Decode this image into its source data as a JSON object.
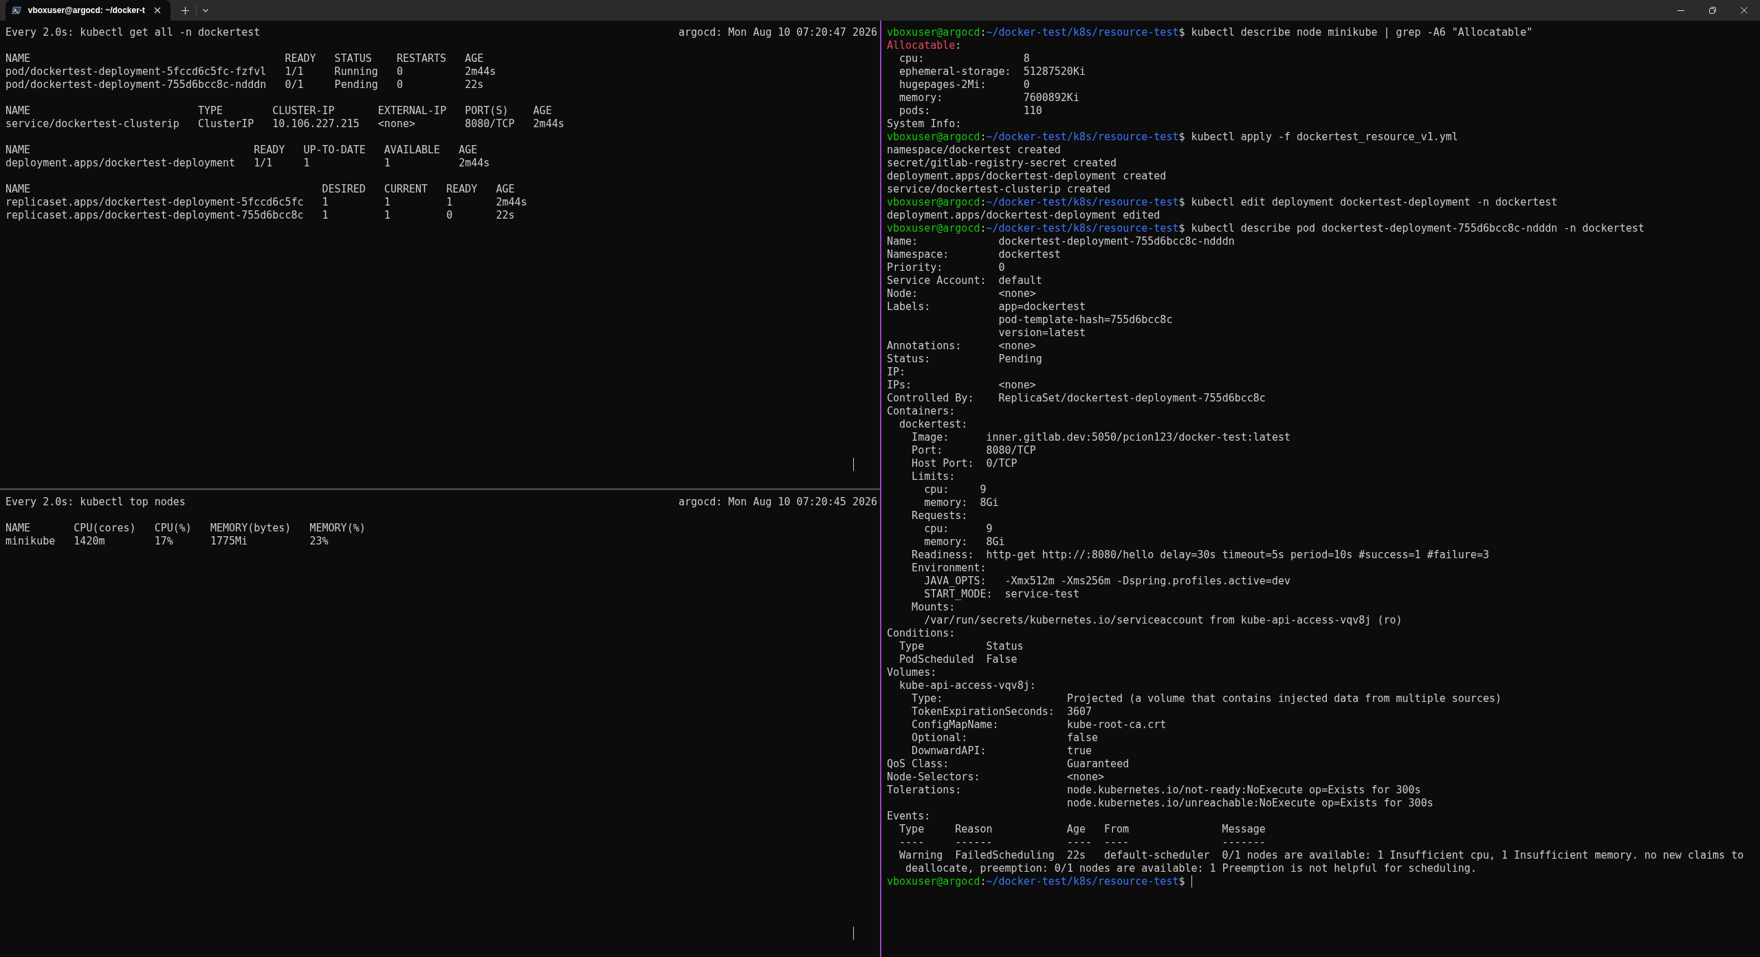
{
  "window": {
    "tabs": [
      {
        "title": "vboxuser@argocd: ~/docker-t",
        "selected": true
      }
    ]
  },
  "left_panes": [
    {
      "watch": {
        "command": "Every 2.0s: kubectl get all -n dockertest",
        "host_time": "argocd: Mon Aug 10 07:20:47 2026"
      },
      "cursor": true,
      "tables": [
        {
          "columns": [
            "NAME",
            "READY",
            "STATUS",
            "RESTARTS",
            "AGE"
          ],
          "rows": [
            [
              "pod/dockertest-deployment-5fccd6c5fc-fzfvl",
              "1/1",
              "Running",
              "0",
              "2m44s"
            ],
            [
              "pod/dockertest-deployment-755d6bcc8c-ndddn",
              "0/1",
              "Pending",
              "0",
              "22s"
            ]
          ]
        },
        {
          "columns": [
            "NAME",
            "TYPE",
            "CLUSTER-IP",
            "EXTERNAL-IP",
            "PORT(S)",
            "AGE"
          ],
          "rows": [
            [
              "service/dockertest-clusterip",
              "ClusterIP",
              "10.106.227.215",
              "<none>",
              "8080/TCP",
              "2m44s"
            ]
          ]
        },
        {
          "columns": [
            "NAME",
            "READY",
            "UP-TO-DATE",
            "AVAILABLE",
            "AGE"
          ],
          "rows": [
            [
              "deployment.apps/dockertest-deployment",
              "1/1",
              "1",
              "1",
              "2m44s"
            ]
          ]
        },
        {
          "columns": [
            "NAME",
            "DESIRED",
            "CURRENT",
            "READY",
            "AGE"
          ],
          "rows": [
            [
              "replicaset.apps/dockertest-deployment-5fccd6c5fc",
              "1",
              "1",
              "1",
              "2m44s"
            ],
            [
              "replicaset.apps/dockertest-deployment-755d6bcc8c",
              "1",
              "1",
              "0",
              "22s"
            ]
          ]
        }
      ]
    },
    {
      "watch": {
        "command": "Every 2.0s: kubectl top nodes",
        "host_time": "argocd: Mon Aug 10 07:20:45 2026"
      },
      "cursor": true,
      "tables": [
        {
          "columns": [
            "NAME",
            "CPU(cores)",
            "CPU(%)",
            "MEMORY(bytes)",
            "MEMORY(%)"
          ],
          "rows": [
            [
              "minikube",
              "1420m",
              "17%",
              "1775Mi",
              "23%"
            ]
          ]
        }
      ]
    }
  ],
  "right_pane": {
    "active": true,
    "entries": [
      {
        "kind": "prompt",
        "user_host": "vboxuser@argocd",
        "separator": ":",
        "path": "~/docker-test/k8s/resource-test",
        "symbol": "$",
        "command": "kubectl describe node minikube | grep -A6 \"Allocatable\"",
        "cursor": false
      },
      {
        "kind": "describe",
        "nodes": [
          {
            "kind": "section",
            "key": [
              {
                "text": "Allocatable",
                "match": true
              },
              {
                "text": ":",
                "match": false
              }
            ],
            "children": [
              {
                "kind": "field",
                "key": "cpu:",
                "value": "8"
              },
              {
                "kind": "field",
                "key": "ephemeral-storage:",
                "value": "51287520Ki"
              },
              {
                "kind": "field",
                "key": "hugepages-2Mi:",
                "value": "0"
              },
              {
                "kind": "field",
                "key": "memory:",
                "value": "7600892Ki"
              },
              {
                "kind": "field",
                "key": "pods:",
                "value": "110"
              }
            ]
          },
          {
            "kind": "section",
            "key": "System Info:"
          }
        ]
      },
      {
        "kind": "prompt",
        "user_host": "vboxuser@argocd",
        "separator": ":",
        "path": "~/docker-test/k8s/resource-test",
        "symbol": "$",
        "command": "kubectl apply -f dockertest_resource_v1.yml",
        "cursor": false
      },
      {
        "kind": "lines",
        "lines": [
          "namespace/dockertest created",
          "secret/gitlab-registry-secret created",
          "deployment.apps/dockertest-deployment created",
          "service/dockertest-clusterip created"
        ]
      },
      {
        "kind": "prompt",
        "user_host": "vboxuser@argocd",
        "separator": ":",
        "path": "~/docker-test/k8s/resource-test",
        "symbol": "$",
        "command": "kubectl edit deployment dockertest-deployment -n dockertest",
        "cursor": false
      },
      {
        "kind": "lines",
        "lines": [
          "deployment.apps/dockertest-deployment edited"
        ]
      },
      {
        "kind": "prompt",
        "user_host": "vboxuser@argocd",
        "separator": ":",
        "path": "~/docker-test/k8s/resource-test",
        "symbol": "$",
        "command": "kubectl describe pod dockertest-deployment-755d6bcc8c-ndddn -n dockertest",
        "cursor": false
      },
      {
        "kind": "describe",
        "nodes": [
          {
            "kind": "field",
            "key": "Name:",
            "value": "dockertest-deployment-755d6bcc8c-ndddn"
          },
          {
            "kind": "field",
            "key": "Namespace:",
            "value": "dockertest"
          },
          {
            "kind": "field",
            "key": "Priority:",
            "value": "0"
          },
          {
            "kind": "field",
            "key": "Service Account:",
            "value": "default"
          },
          {
            "kind": "field",
            "key": "Node:",
            "value": "<none>"
          },
          {
            "kind": "field",
            "key": "Labels:",
            "value": [
              "app=dockertest",
              "pod-template-hash=755d6bcc8c",
              "version=latest"
            ]
          },
          {
            "kind": "field",
            "key": "Annotations:",
            "value": "<none>"
          },
          {
            "kind": "field",
            "key": "Status:",
            "value": "Pending"
          },
          {
            "kind": "field",
            "key": "IP:"
          },
          {
            "kind": "field",
            "key": "IPs:",
            "value": "<none>"
          },
          {
            "kind": "field",
            "key": "Controlled By:",
            "value": "ReplicaSet/dockertest-deployment-755d6bcc8c"
          },
          {
            "kind": "section",
            "key": "Containers:",
            "children": [
              {
                "kind": "section",
                "key": "dockertest:",
                "children": [
                  {
                    "kind": "field",
                    "key": "Image:",
                    "value": "inner.gitlab.dev:5050/pcion123/docker-test:latest"
                  },
                  {
                    "kind": "field",
                    "key": "Port:",
                    "value": "8080/TCP"
                  },
                  {
                    "kind": "field",
                    "key": "Host Port:",
                    "value": "0/TCP"
                  },
                  {
                    "kind": "section",
                    "key": "Limits:",
                    "children": [
                      {
                        "kind": "field",
                        "key": "cpu:",
                        "value": "9"
                      },
                      {
                        "kind": "field",
                        "key": "memory:",
                        "value": "8Gi"
                      }
                    ]
                  },
                  {
                    "kind": "section",
                    "key": "Requests:",
                    "children": [
                      {
                        "kind": "field",
                        "key": "cpu:",
                        "value": "9"
                      },
                      {
                        "kind": "field",
                        "key": "memory:",
                        "value": "8Gi"
                      }
                    ]
                  },
                  {
                    "kind": "field",
                    "key": "Readiness:",
                    "value": "http-get http://:8080/hello delay=30s timeout=5s period=10s #success=1 #failure=3"
                  },
                  {
                    "kind": "section",
                    "key": "Environment:",
                    "children": [
                      {
                        "kind": "field",
                        "key": "JAVA_OPTS:",
                        "value": "-Xmx512m -Xms256m -Dspring.profiles.active=dev"
                      },
                      {
                        "kind": "field",
                        "key": "START_MODE:",
                        "value": "service-test"
                      }
                    ]
                  },
                  {
                    "kind": "section",
                    "key": "Mounts:",
                    "children": [
                      {
                        "kind": "text",
                        "text": "/var/run/secrets/kubernetes.io/serviceaccount from kube-api-access-vqv8j (ro)"
                      }
                    ]
                  }
                ]
              }
            ]
          },
          {
            "kind": "section",
            "key": "Conditions:",
            "children": [
              {
                "kind": "table",
                "columns": [
                  "Type",
                  "Status"
                ],
                "rows": [
                  [
                    "PodScheduled",
                    "False"
                  ]
                ]
              }
            ]
          },
          {
            "kind": "section",
            "key": "Volumes:",
            "children": [
              {
                "kind": "section",
                "key": "kube-api-access-vqv8j:",
                "children": [
                  {
                    "kind": "field",
                    "key": "Type:",
                    "value": "Projected (a volume that contains injected data from multiple sources)"
                  },
                  {
                    "kind": "field",
                    "key": "TokenExpirationSeconds:",
                    "value": "3607"
                  },
                  {
                    "kind": "field",
                    "key": "ConfigMapName:",
                    "value": "kube-root-ca.crt"
                  },
                  {
                    "kind": "field",
                    "key": "Optional:",
                    "value": "false"
                  },
                  {
                    "kind": "field",
                    "key": "DownwardAPI:",
                    "value": "true"
                  }
                ]
              }
            ]
          },
          {
            "kind": "field",
            "key": "QoS Class:",
            "value": "Guaranteed"
          },
          {
            "kind": "field",
            "key": "Node-Selectors:",
            "value": "<none>"
          },
          {
            "kind": "field",
            "key": "Tolerations:",
            "value": [
              "node.kubernetes.io/not-ready:NoExecute op=Exists for 300s",
              "node.kubernetes.io/unreachable:NoExecute op=Exists for 300s"
            ]
          },
          {
            "kind": "section",
            "key": "Events:",
            "children": [
              {
                "kind": "table",
                "columns": [
                  "Type",
                  "Reason",
                  "Age",
                  "From",
                  "Message"
                ],
                "underlines": [
                  "----",
                  "------",
                  "----",
                  "----",
                  "-------"
                ],
                "rows": [
                  [
                    "Warning",
                    "FailedScheduling",
                    "22s",
                    "default-scheduler",
                    "0/1 nodes are available: 1 Insufficient cpu, 1 Insufficient memory. no new claims to deallocate, preemption: 0/1 nodes are available: 1 Preemption is not helpful for scheduling."
                  ]
                ]
              }
            ]
          }
        ]
      },
      {
        "kind": "prompt",
        "user_host": "vboxuser@argocd",
        "separator": ":",
        "path": "~/docker-test/k8s/resource-test",
        "symbol": "$",
        "cursor": true
      }
    ]
  }
}
